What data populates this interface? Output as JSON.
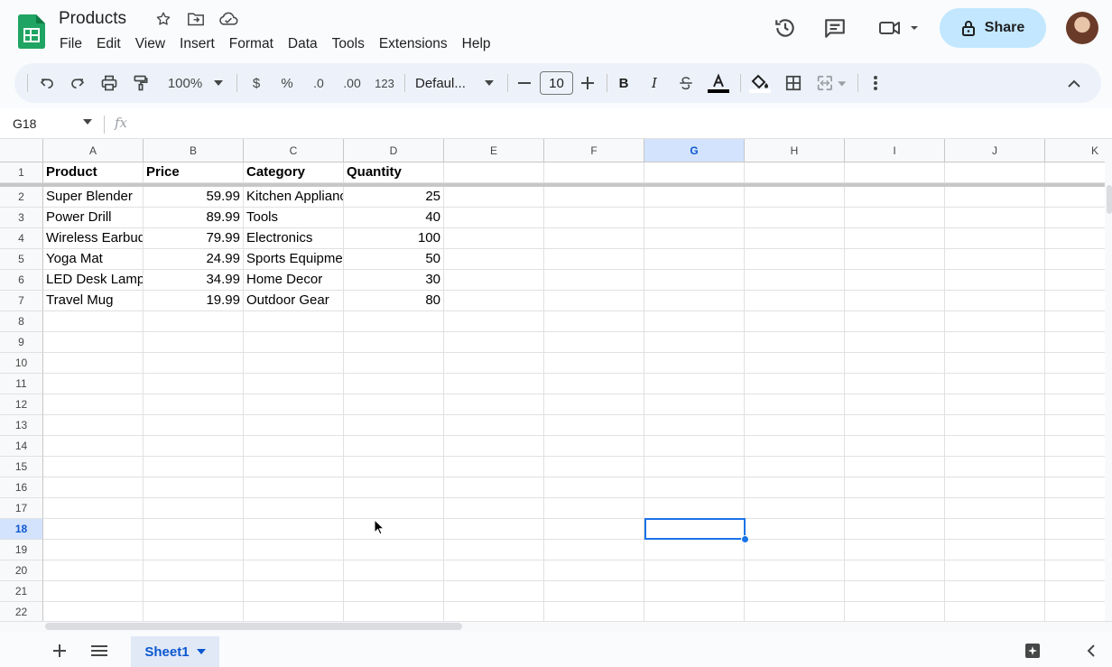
{
  "app": {
    "title": "Products",
    "menus": [
      "File",
      "Edit",
      "View",
      "Insert",
      "Format",
      "Data",
      "Tools",
      "Extensions",
      "Help"
    ],
    "share_label": "Share",
    "accent_color": "#0b57d0",
    "share_color": "#c2e7ff"
  },
  "toolbar": {
    "zoom": "100%",
    "currency": "$",
    "percent": "%",
    "decimal_decrease": ".0",
    "decimal_increase": ".00",
    "number_format": "123",
    "font": "Defaul...",
    "font_size": "10",
    "bold": "B",
    "italic": "I"
  },
  "formula_bar": {
    "cell_ref": "G18",
    "fx": "fx",
    "content": ""
  },
  "sheet": {
    "columns": [
      "A",
      "B",
      "C",
      "D",
      "E",
      "F",
      "G",
      "H",
      "I",
      "J",
      "K"
    ],
    "selected_column": "G",
    "row_numbers": [
      "1",
      "2",
      "3",
      "4",
      "5",
      "6",
      "7",
      "8",
      "9",
      "10",
      "11",
      "12",
      "13",
      "14",
      "15",
      "16",
      "17",
      "18",
      "19",
      "20",
      "21",
      "22"
    ],
    "selected_row": "18",
    "header": [
      "Product",
      "Price",
      "Category",
      "Quantity"
    ],
    "rows": [
      [
        "Super Blender",
        "59.99",
        "Kitchen Appliances",
        "25"
      ],
      [
        "Power Drill",
        "89.99",
        "Tools",
        "40"
      ],
      [
        "Wireless Earbuds",
        "79.99",
        "Electronics",
        "100"
      ],
      [
        "Yoga Mat",
        "24.99",
        "Sports Equipment",
        "50"
      ],
      [
        "LED Desk Lamp",
        "34.99",
        "Home Decor",
        "30"
      ],
      [
        "Travel Mug",
        "19.99",
        "Outdoor Gear",
        "80"
      ]
    ]
  },
  "tabs": {
    "active": "Sheet1"
  }
}
